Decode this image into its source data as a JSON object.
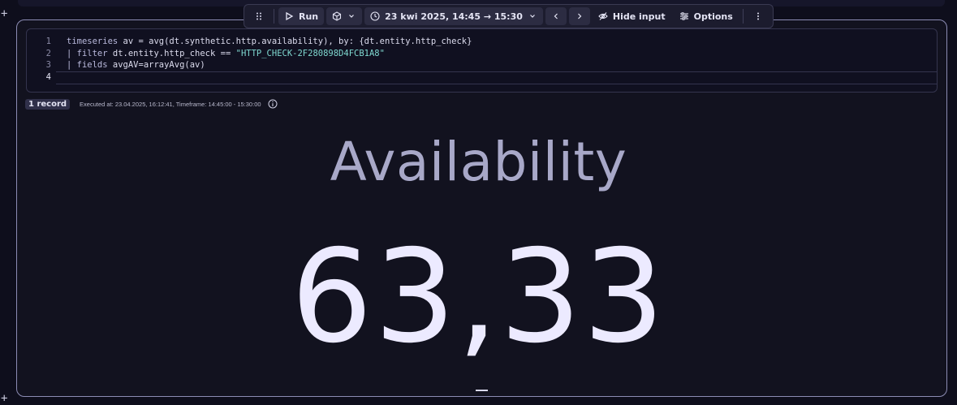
{
  "toolbar": {
    "run_label": "Run",
    "timeframe_label": "23 kwi 2025, 14:45 → 15:30",
    "hide_input_label": "Hide input",
    "options_label": "Options"
  },
  "editor": {
    "line_numbers": [
      "1",
      "2",
      "3",
      "4"
    ],
    "lines": [
      {
        "kw": "timeseries",
        "rest": " av = avg(dt.synthetic.http.availability), by: {dt.entity.http_check}"
      },
      {
        "kw": "| filter",
        "rest": " dt.entity.http_check == ",
        "str": "\"HTTP_CHECK-2F280898D4FCB1A8\""
      },
      {
        "kw": "| fields",
        "rest": " avgAV=arrayAvg(av)"
      },
      {
        "kw": "",
        "rest": ""
      }
    ]
  },
  "meta": {
    "record_badge": "1 record",
    "executed_text": "Executed at: 23.04.2025, 16:12:41, Timeframe: 14:45:00 - 15:30:00"
  },
  "single_value": {
    "label": "Availability",
    "value": "63,33"
  },
  "colors": {
    "accent_border": "#8c8cb4",
    "string_literal": "#7fd8d0",
    "background": "#12121f"
  }
}
